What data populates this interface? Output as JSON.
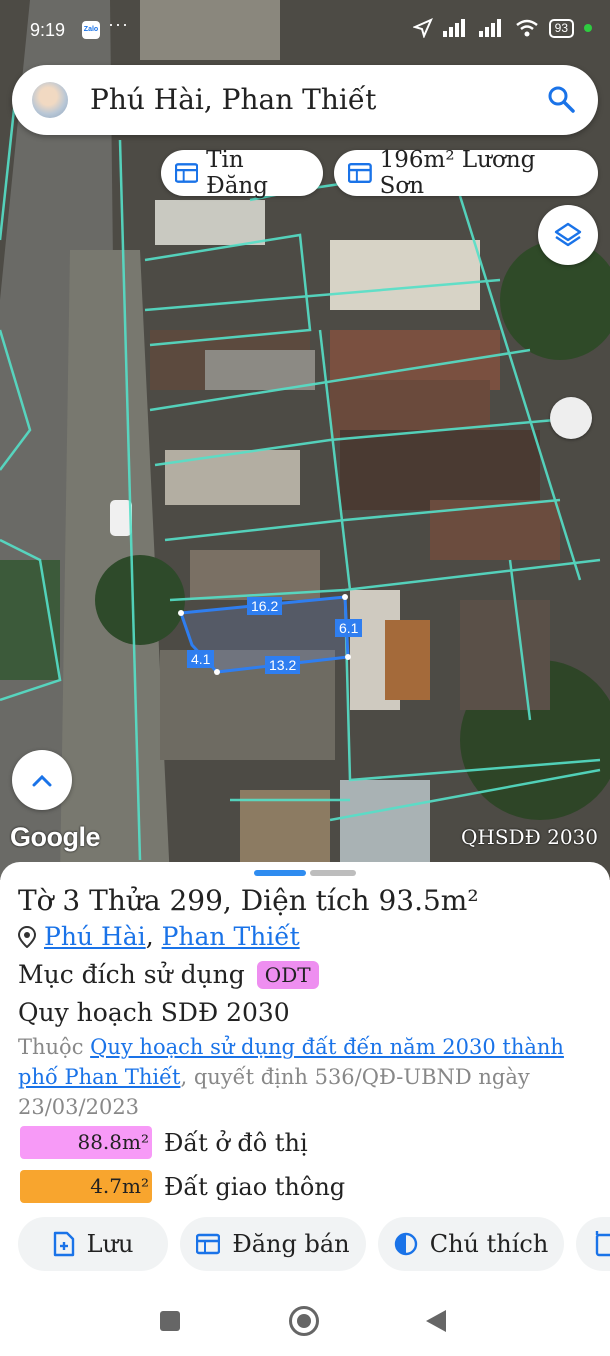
{
  "status_bar": {
    "time": "9:19",
    "app_badge": "Zalo",
    "more": "···",
    "battery": "93"
  },
  "search": {
    "query": "Phú Hài, Phan Thiết",
    "icon": "search-icon"
  },
  "chips": [
    {
      "label": "Tin Đăng",
      "icon": "calendar-icon"
    },
    {
      "label": "196m² Lương Sơn",
      "icon": "calendar-icon"
    }
  ],
  "map": {
    "attribution": "Google",
    "overlay_label": "QHSDĐ 2030",
    "dimensions": {
      "top": "16.2",
      "right": "6.1",
      "bottom": "13.2",
      "left": "4.1"
    }
  },
  "sheet": {
    "title": "Tờ 3 Thửa 299, Diện tích 93.5m²",
    "location": {
      "ward": "Phú Hài",
      "separator": ", ",
      "city": "Phan Thiết"
    },
    "purpose_label": "Mục đích sử dụng",
    "purpose_code": "ODT",
    "plan_title": "Quy hoạch SDĐ 2030",
    "plan_prefix": "Thuộc ",
    "plan_link": "Quy hoạch sử dụng đất đến năm 2030 thành phố Phan Thiết",
    "plan_suffix": ", quyết định 536/QĐ-UBND ngày 23/03/2023",
    "areas": [
      {
        "value": "88.8m²",
        "label": "Đất ở đô thị",
        "color": "#f79af7"
      },
      {
        "value": "4.7m²",
        "label": "Đất giao thông",
        "color": "#f8a52e"
      }
    ],
    "actions": [
      {
        "label": "Lưu",
        "icon": "file-add-icon"
      },
      {
        "label": "Đăng bán",
        "icon": "calendar-icon"
      },
      {
        "label": "Chú thích",
        "icon": "contrast-icon"
      },
      {
        "label": "",
        "icon": "add-chart-icon"
      }
    ]
  },
  "colors": {
    "accent": "#1a73e8",
    "parcel_lines": "#55e0c8",
    "selection": "#2f7ef0"
  }
}
